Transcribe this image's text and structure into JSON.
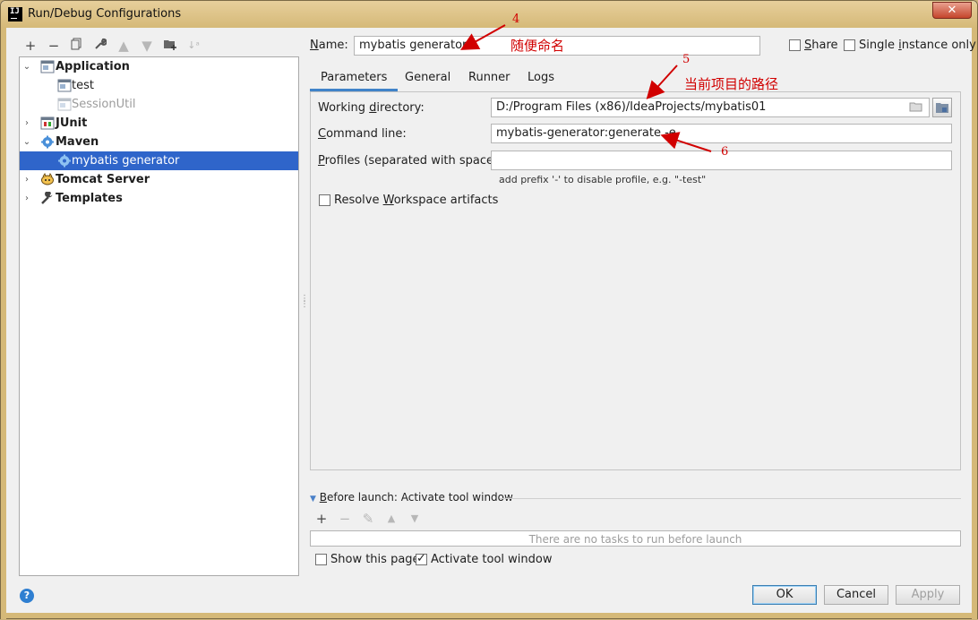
{
  "window": {
    "title": "Run/Debug Configurations",
    "close_glyph": "✕"
  },
  "toolbar": {
    "icons": [
      "add-icon",
      "remove-icon",
      "copy-icon",
      "wrench-icon",
      "move-up-icon",
      "move-down-icon",
      "new-folder-icon",
      "sort-icon"
    ]
  },
  "tree": {
    "items": [
      {
        "label": "Application",
        "bold": true,
        "expanded": true,
        "icon": "application-icon"
      },
      {
        "label": "test",
        "icon": "application-config-icon"
      },
      {
        "label": "SessionUtil",
        "icon": "application-config-icon-disabled"
      },
      {
        "label": "JUnit",
        "bold": true,
        "expanded": false,
        "icon": "junit-icon"
      },
      {
        "label": "Maven",
        "bold": true,
        "expanded": true,
        "icon": "maven-gear-icon"
      },
      {
        "label": "mybatis generator",
        "selected": true,
        "icon": "maven-gear-icon"
      },
      {
        "label": "Tomcat Server",
        "bold": true,
        "expanded": false,
        "icon": "tomcat-icon"
      },
      {
        "label": "Templates",
        "bold": true,
        "expanded": false,
        "icon": "wrench-icon"
      }
    ]
  },
  "name": {
    "label_prefix": "N",
    "label_rest": "ame:",
    "value": "mybatis generator"
  },
  "share": {
    "label_prefix": "S",
    "label_rest": "hare",
    "checked": false
  },
  "single_instance": {
    "label_prefix": "Single ",
    "label_u": "i",
    "label_rest": "nstance only",
    "checked": false
  },
  "tabs": [
    {
      "label": "Parameters",
      "active": true
    },
    {
      "label": "General"
    },
    {
      "label": "Runner"
    },
    {
      "label": "Logs"
    }
  ],
  "parameters": {
    "working_directory": {
      "label_prefix": "Working ",
      "label_u": "d",
      "label_rest": "irectory:",
      "value": "D:/Program Files (x86)/IdeaProjects/mybatis01"
    },
    "command_line": {
      "label_prefix": "C",
      "label_rest": "ommand line:",
      "value": "mybatis-generator:generate -e"
    },
    "profiles": {
      "label_prefix": "P",
      "label_rest": "rofiles (separated with space):",
      "value": "",
      "hint": "add prefix '-' to disable profile, e.g. \"-test\""
    },
    "resolve_workspace": {
      "label_prefix": "Resolve ",
      "label_u": "W",
      "label_rest": "orkspace artifacts",
      "checked": false
    }
  },
  "before_launch": {
    "label_u": "B",
    "label_rest": "efore launch: Activate tool window",
    "icons": [
      "add-icon",
      "remove-icon",
      "edit-icon",
      "move-up-icon",
      "move-down-icon"
    ],
    "empty_text": "There are no tasks to run before launch",
    "show_this_page": {
      "label": "Show this page",
      "checked": false
    },
    "activate_tool_window": {
      "label": "Activate tool window",
      "checked": true
    }
  },
  "buttons": {
    "ok": "OK",
    "cancel": "Cancel",
    "apply": "Apply",
    "help": "?"
  },
  "annotations": {
    "n4": "4",
    "n4_text": "随便命名",
    "n5": "5",
    "n5_text": "当前项目的路径",
    "n6": "6",
    "color": "#d10000"
  }
}
